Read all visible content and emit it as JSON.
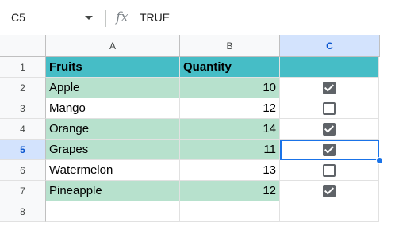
{
  "formula_bar": {
    "cell_ref": "C5",
    "fx_label": "fx",
    "value": "TRUE"
  },
  "columns": [
    "A",
    "B",
    "C"
  ],
  "rows": [
    "1",
    "2",
    "3",
    "4",
    "5",
    "6",
    "7",
    "8"
  ],
  "table": {
    "header": {
      "fruit": "Fruits",
      "quantity": "Quantity"
    },
    "items": [
      {
        "fruit": "Apple",
        "quantity": "10",
        "checked": true
      },
      {
        "fruit": "Mango",
        "quantity": "12",
        "checked": false
      },
      {
        "fruit": "Orange",
        "quantity": "14",
        "checked": true
      },
      {
        "fruit": "Grapes",
        "quantity": "11",
        "checked": true
      },
      {
        "fruit": "Watermelon",
        "quantity": "13",
        "checked": false
      },
      {
        "fruit": "Pineapple",
        "quantity": "12",
        "checked": true
      }
    ]
  },
  "selected_cell": "C5",
  "colors": {
    "header_fill": "#46bdc6",
    "band_fill": "#b7e1cd",
    "selection": "#1a73e8"
  }
}
